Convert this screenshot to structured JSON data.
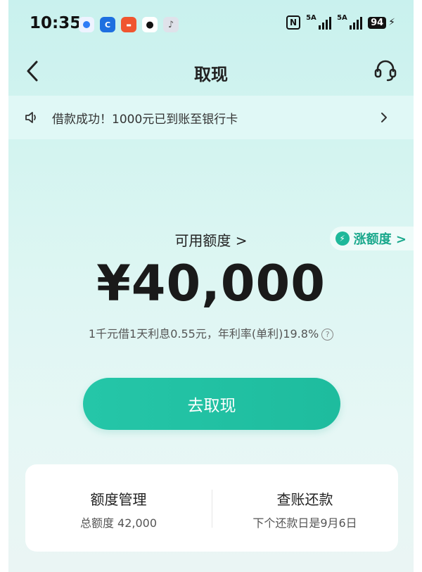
{
  "status_bar": {
    "time": "10:35",
    "app_icons": [
      "blue-dot-icon",
      "c-app-icon",
      "red-app-icon",
      "qq-penguin-icon",
      "tiktok-icon"
    ],
    "network1": "5A",
    "network2": "5A",
    "battery": "94"
  },
  "nav": {
    "title": "取现"
  },
  "notice": {
    "text": "借款成功！1000元已到账至银行卡"
  },
  "quota": {
    "label": "可用额度 >",
    "raise_label": "涨额度 >",
    "amount": "¥40,000",
    "rate_text": "1千元借1天利息0.55元，年利率(单利)19.8%"
  },
  "cta": {
    "label": "去取现"
  },
  "card": {
    "left_title": "额度管理",
    "left_sub": "总额度 42,000",
    "right_title": "查账还款",
    "right_sub": "下个还款日是9月6日"
  },
  "colors": {
    "accent": "#1fbf9f",
    "bg_top": "#c9f1ee",
    "text": "#222222"
  }
}
